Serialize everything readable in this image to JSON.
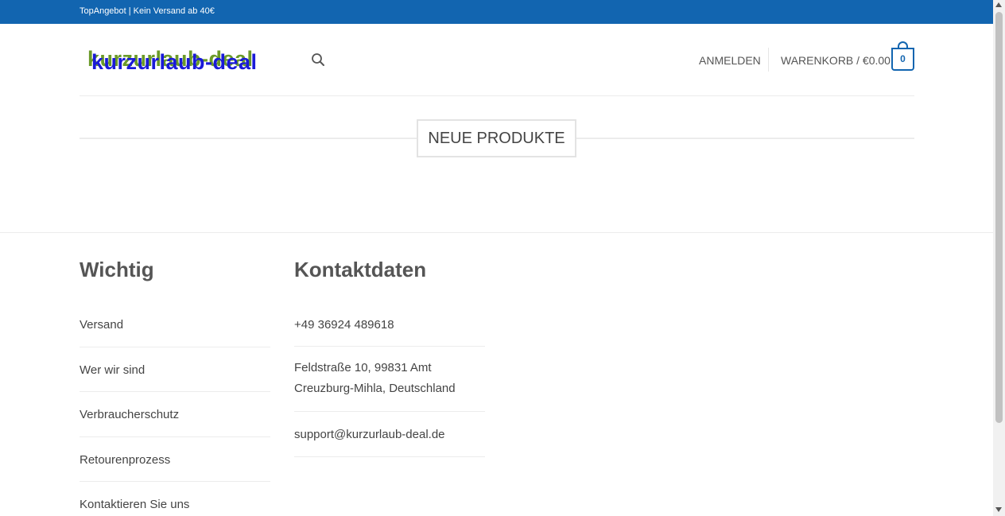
{
  "topbar": {
    "text": "TopAngebot | Kein Versand ab 40€"
  },
  "header": {
    "logo_text": "kurzurlaub-deal",
    "login_label": "ANMELDEN",
    "cart_label": "WARENKORB / €0.00",
    "cart_count": "0",
    "brand_color": "#1265b0"
  },
  "main": {
    "section_title": "NEUE PRODUKTE"
  },
  "footer": {
    "wichtig": {
      "title": "Wichtig",
      "items": [
        "Versand",
        "Wer wir sind",
        "Verbraucherschutz",
        "Retourenprozess",
        "Kontaktieren Sie uns"
      ]
    },
    "kontakt": {
      "title": "Kontaktdaten",
      "phone": "+49 36924 489618",
      "address_line1": "Feldstraße 10, 99831 Amt",
      "address_line2": "Creuzburg-Mihla, Deutschland",
      "email": "support@kurzurlaub-deal.de"
    }
  }
}
